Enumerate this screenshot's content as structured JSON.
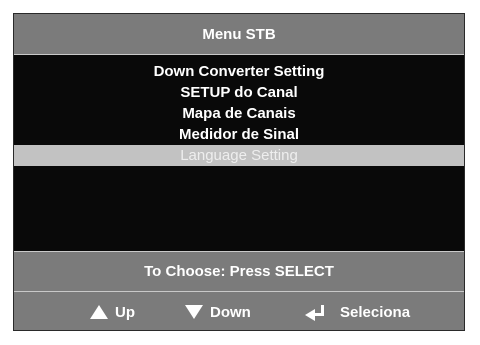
{
  "title": "Menu STB",
  "menu": {
    "items": [
      {
        "label": "Down Converter Setting"
      },
      {
        "label": "SETUP do Canal"
      },
      {
        "label": "Mapa de Canais"
      },
      {
        "label": "Medidor de Sinal"
      },
      {
        "label": "Language Setting"
      }
    ],
    "selected_index": 4
  },
  "prompt": "To Choose: Press SELECT",
  "legend": {
    "up_label": "Up",
    "up_icon": "triangle-up-icon",
    "down_label": "Down",
    "down_icon": "triangle-down-icon",
    "select_label": "Seleciona",
    "select_icon": "enter-arrow-icon"
  },
  "colors": {
    "panel": "#7b7b7b",
    "menu_background": "#090909",
    "highlight": "#c2c2c2",
    "text": "#ffffff"
  }
}
